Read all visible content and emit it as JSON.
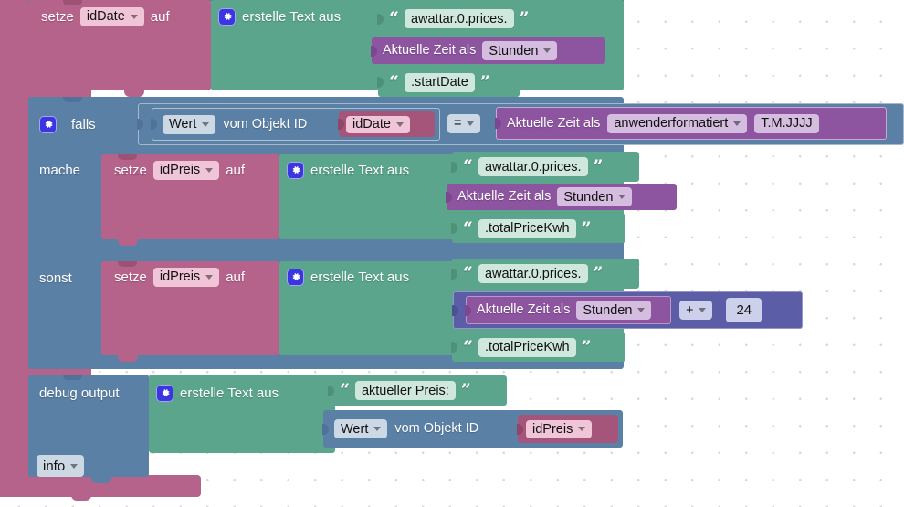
{
  "editor": {
    "name": "blockly-workspace",
    "background": "#ffffff",
    "grid_dot_color": "#d7d7de"
  },
  "colors": {
    "variable": "#b5638a",
    "text": "#5ba58c",
    "control": "#5b80a5",
    "time": "#8d54a0",
    "math": "#5b5ea6",
    "gear_icon": "#3b37e0"
  },
  "blocks": {
    "set_iddate": {
      "keyword": "setze",
      "variable": "idDate",
      "assign_word": "auf",
      "create_text": "erstelle Text aus",
      "items": [
        {
          "kind": "string",
          "value": "awattar.0.prices."
        },
        {
          "kind": "time",
          "label": "Aktuelle Zeit als",
          "unit": "Stunden"
        },
        {
          "kind": "string",
          "value": ".startDate"
        }
      ]
    },
    "if_block": {
      "if_label": "falls",
      "do_label": "mache",
      "else_label": "sonst",
      "condition": {
        "left": {
          "selector": "Wert",
          "phrase": "vom Objekt ID",
          "object_id": "idDate"
        },
        "operator": "=",
        "right": {
          "label": "Aktuelle Zeit als",
          "format": "anwenderformatiert",
          "pattern": "T.M.JJJJ"
        }
      },
      "do_branch": {
        "keyword": "setze",
        "variable": "idPreis",
        "assign_word": "auf",
        "create_text": "erstelle Text aus",
        "items": [
          {
            "kind": "string",
            "value": "awattar.0.prices."
          },
          {
            "kind": "time",
            "label": "Aktuelle Zeit als",
            "unit": "Stunden"
          },
          {
            "kind": "string",
            "value": ".totalPriceKwh"
          }
        ]
      },
      "else_branch": {
        "keyword": "setze",
        "variable": "idPreis",
        "assign_word": "auf",
        "create_text": "erstelle Text aus",
        "items": [
          {
            "kind": "string",
            "value": "awattar.0.prices."
          },
          {
            "kind": "math",
            "label": "Aktuelle Zeit als",
            "unit": "Stunden",
            "operator": "+",
            "operand": "24"
          },
          {
            "kind": "string",
            "value": ".totalPriceKwh"
          }
        ]
      }
    },
    "debug": {
      "label": "debug output",
      "create_text": "erstelle Text aus",
      "items": [
        {
          "kind": "string",
          "value": "aktueller Preis:"
        },
        {
          "kind": "object",
          "selector": "Wert",
          "phrase": "vom Objekt ID",
          "object_id": "idPreis"
        }
      ],
      "level": "info"
    }
  }
}
